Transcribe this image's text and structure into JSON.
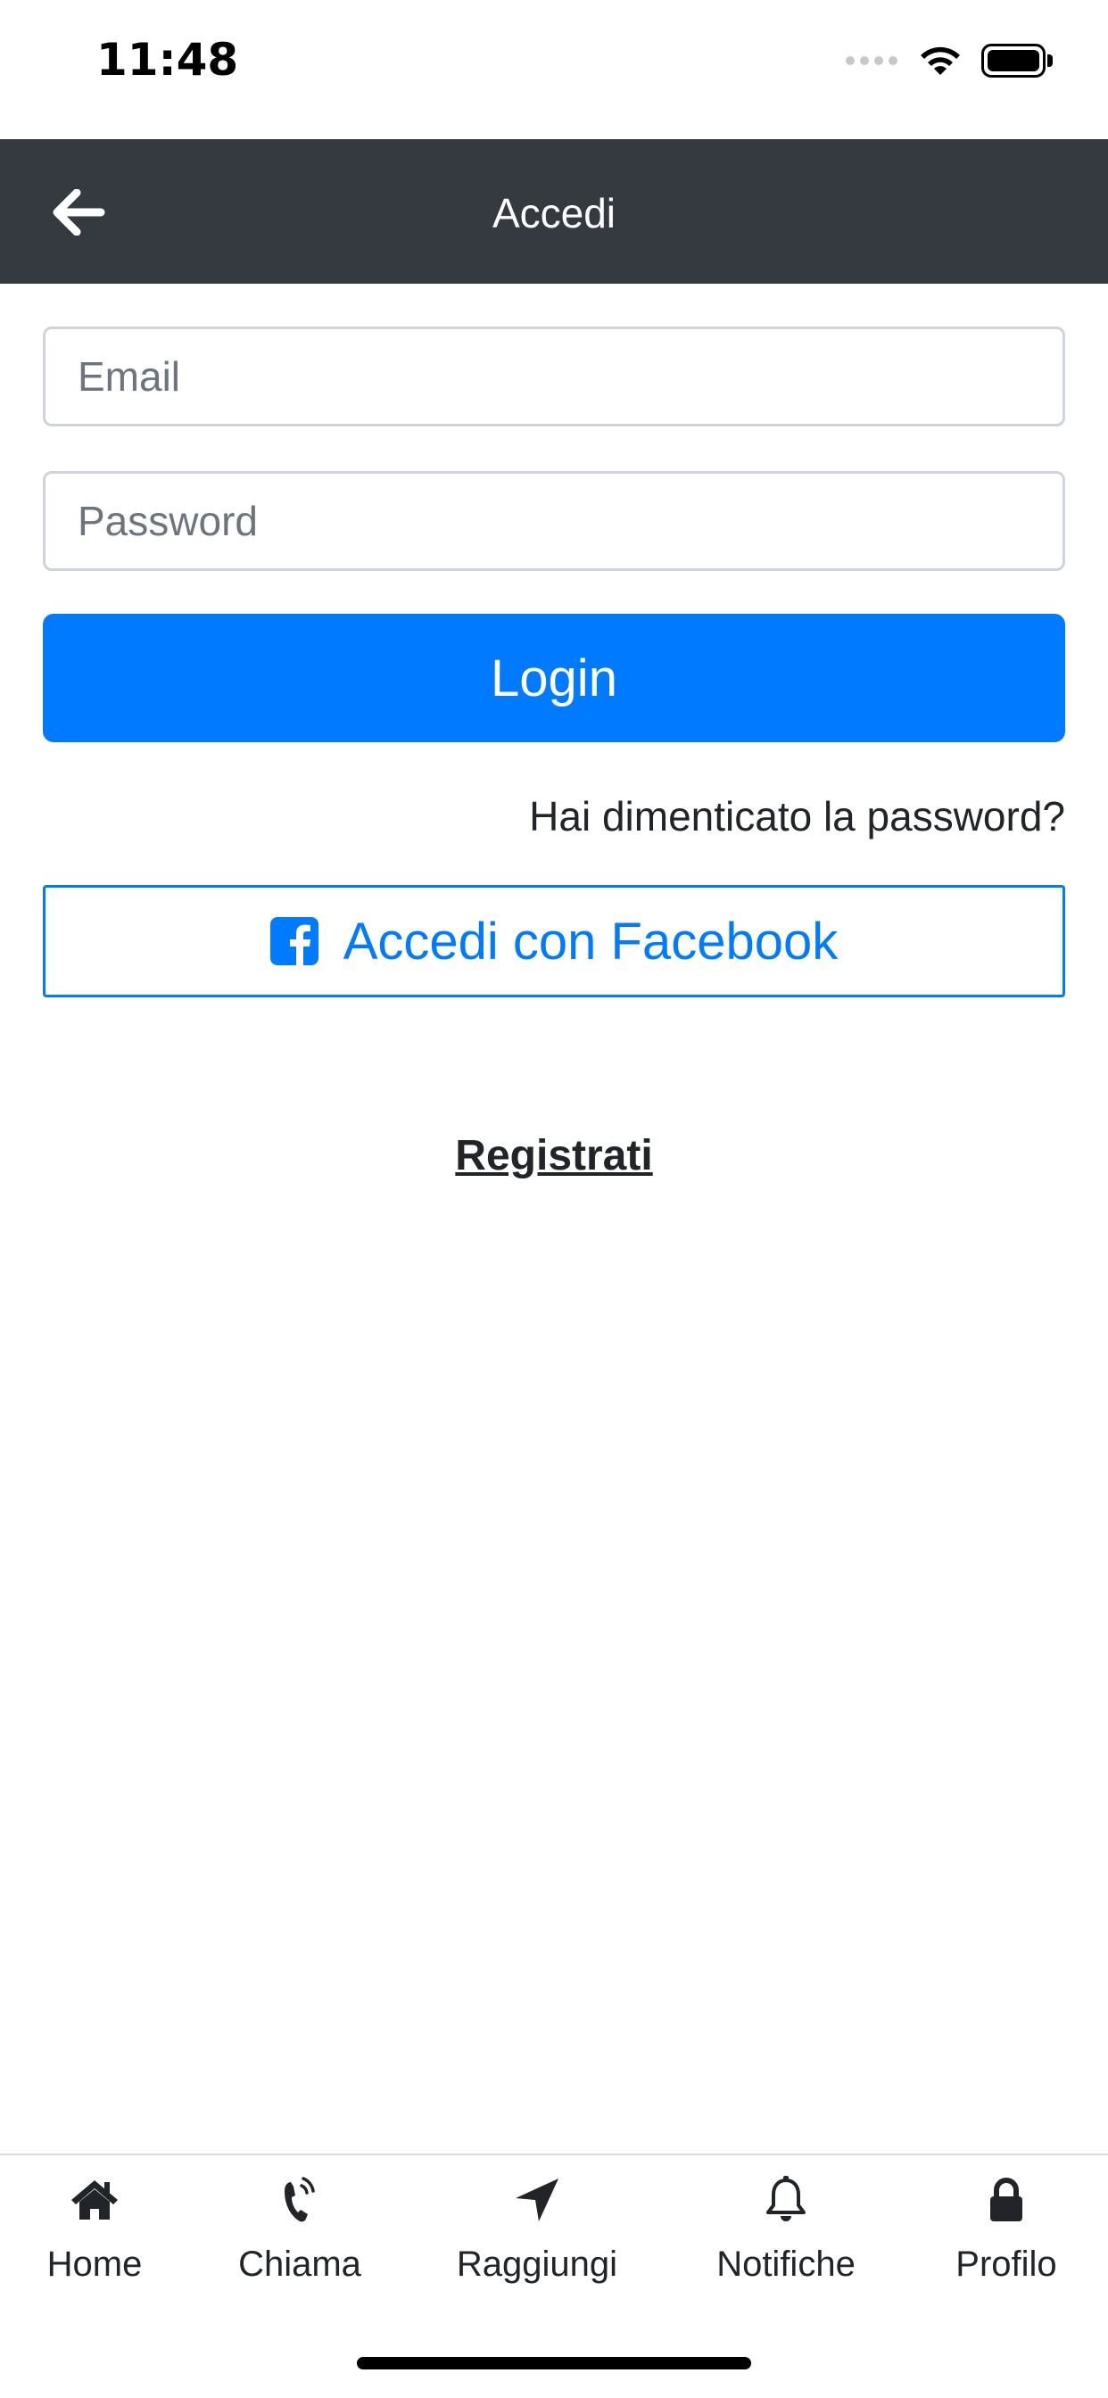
{
  "status_bar": {
    "time": "11:48",
    "signal_icon": "signal-dots-icon",
    "wifi_icon": "wifi-icon",
    "battery_icon": "battery-full-icon"
  },
  "header": {
    "title": "Accedi",
    "back_icon": "arrow-left-icon",
    "background_color": "#343a40"
  },
  "form": {
    "email": {
      "value": "",
      "placeholder": "Email"
    },
    "password": {
      "value": "",
      "placeholder": "Password"
    },
    "login_label": "Login",
    "forgot_label": "Hai dimenticato la password?",
    "facebook_label": "Accedi con Facebook",
    "facebook_icon": "facebook-square-icon",
    "register_label": "Registrati"
  },
  "tab_bar": {
    "items": [
      {
        "label": "Home",
        "icon": "home-icon"
      },
      {
        "label": "Chiama",
        "icon": "phone-icon"
      },
      {
        "label": "Raggiungi",
        "icon": "location-arrow-icon"
      },
      {
        "label": "Notifiche",
        "icon": "bell-icon"
      },
      {
        "label": "Profilo",
        "icon": "lock-icon"
      }
    ]
  },
  "colors": {
    "accent": "#007bff",
    "navbar": "#343a40",
    "text": "#212529"
  }
}
